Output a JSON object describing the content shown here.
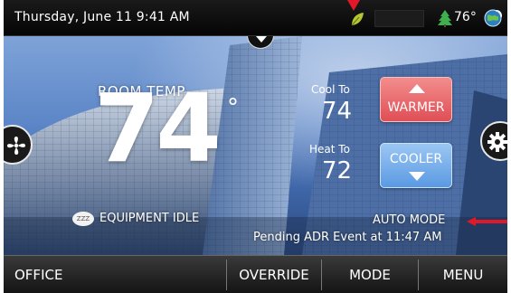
{
  "status_bar": {
    "datetime": "Thursday, June 11  9:41 AM",
    "outdoor_temp": "76°",
    "icons": [
      "leaf-icon",
      "tree-icon",
      "globe-icon"
    ]
  },
  "room": {
    "label": "ROOM TEMP",
    "value": "74",
    "degree": "°"
  },
  "setpoints": {
    "cool_label": "Cool To",
    "cool_value": "74",
    "heat_label": "Heat To",
    "heat_value": "72"
  },
  "controls": {
    "warmer_label": "WARMER",
    "cooler_label": "COOLER",
    "warmer_color": "#e45a60",
    "cooler_color": "#6ea8e8"
  },
  "status": {
    "zzz": "ZZZ",
    "equipment": "EQUIPMENT IDLE",
    "mode": "AUTO MODE",
    "adr_event": "Pending ADR Event at 11:47 AM"
  },
  "nav": {
    "office": "OFFICE",
    "override": "OVERRIDE",
    "mode": "MODE",
    "menu": "MENU"
  },
  "annotation_color": "#e0182a"
}
